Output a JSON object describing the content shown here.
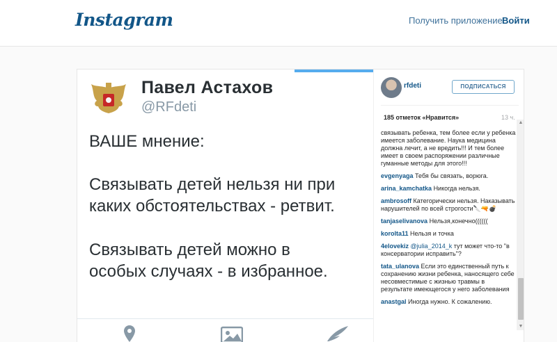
{
  "header": {
    "logo_text": "Instagram",
    "get_app_label": "Получить приложение",
    "login_label": "Войти"
  },
  "post_image": {
    "author_name": "Павел Астахов",
    "author_handle": "@RFdeti",
    "lines": [
      "ВАШЕ мнение:",
      "Связывать детей нельзя ни при",
      "каких обстоятельствах - ретвит.",
      "Связывать детей можно в",
      "особых случаях - в избранное."
    ],
    "footer_icons": [
      "location-icon",
      "image-icon",
      "compose-icon"
    ]
  },
  "sidebar": {
    "owner": "rfdeti",
    "follow_label": "ПОДПИСАТЬСЯ",
    "likes_text": "185 отметок «Нравится»",
    "time_text": "13 ч.",
    "comments": [
      {
        "user": "",
        "text": "связывать ребенка, тем более если у ребенка имеется заболевание. Наука медицина должна лечит, а не вредить!!! И тем более имеет в своем распоряжении различные гуманные методы для этого!!!"
      },
      {
        "user": "evgenyaga",
        "text": "Тебя бы связать, ворюга."
      },
      {
        "user": "arina_kamchatka",
        "text": "Никогда нельзя."
      },
      {
        "user": "ambrosoff",
        "text": "Категорически нельзя. Наказывать нарушителей по всей строгости🔪🔫💣"
      },
      {
        "user": "tanjaselivanova",
        "text": "Нельзя,конечно(((((("
      },
      {
        "user": "koroltа11",
        "text": "Нельзя и точка"
      },
      {
        "user": "4elovekiz",
        "mention": "@julia_2014_k",
        "text": "тут может что-то \"в консерватории исправить\"?"
      },
      {
        "user": "tata_ulanova",
        "text": "Если это единственный путь к сохранению жизни ребенка, наносящего себе несовместимые с жизнью травмы в результате имеющегося у него заболевания"
      },
      {
        "user": "anastgal",
        "text": "Иногда нужно. К сожалению."
      }
    ]
  },
  "colors": {
    "brand": "#125688",
    "link": "#3f729b",
    "twitter_blue": "#55acee"
  }
}
